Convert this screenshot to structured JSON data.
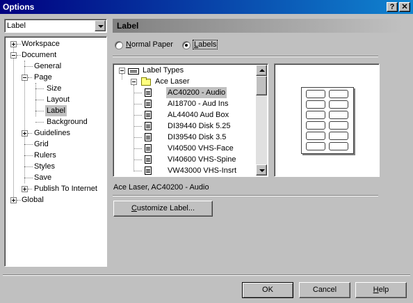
{
  "window": {
    "title": "Options",
    "help_glyph": "?",
    "close_glyph": "✕"
  },
  "category_combo": {
    "value": "Label"
  },
  "tree": {
    "workspace": "Workspace",
    "document": "Document",
    "general": "General",
    "page": "Page",
    "size": "Size",
    "layout": "Layout",
    "label": "Label",
    "background": "Background",
    "guidelines": "Guidelines",
    "grid": "Grid",
    "rulers": "Rulers",
    "styles": "Styles",
    "save": "Save",
    "publish": "Publish To Internet",
    "global": "Global"
  },
  "panel": {
    "title": "Label"
  },
  "radios": {
    "normal_paper": {
      "prefix": "",
      "mnemonic": "N",
      "rest": "ormal Paper",
      "checked": false
    },
    "labels": {
      "prefix": "",
      "mnemonic": "L",
      "rest": "abels",
      "checked": true
    }
  },
  "label_list": {
    "root": "Label Types",
    "group": "Ace Laser",
    "items": [
      "AC40200 - Audio",
      "AI18700 - Aud Ins",
      "AL44040 Aud Box",
      "DI39440 Disk 5.25",
      "DI39540 Disk 3.5",
      "VI40500 VHS-Face",
      "VI40600 VHS-Spine",
      "VW43000 VHS-Insrt"
    ],
    "selected_index": 0
  },
  "selection_text": "Ace Laser, AC40200 - Audio",
  "buttons": {
    "customize": {
      "mnemonic": "C",
      "rest": "ustomize Label..."
    },
    "ok": "OK",
    "cancel": "Cancel",
    "help": {
      "mnemonic": "H",
      "rest": "elp"
    }
  },
  "colors": {
    "title_bar": "#000080",
    "face": "#c0c0c0",
    "selection": "#c0c0c0"
  }
}
